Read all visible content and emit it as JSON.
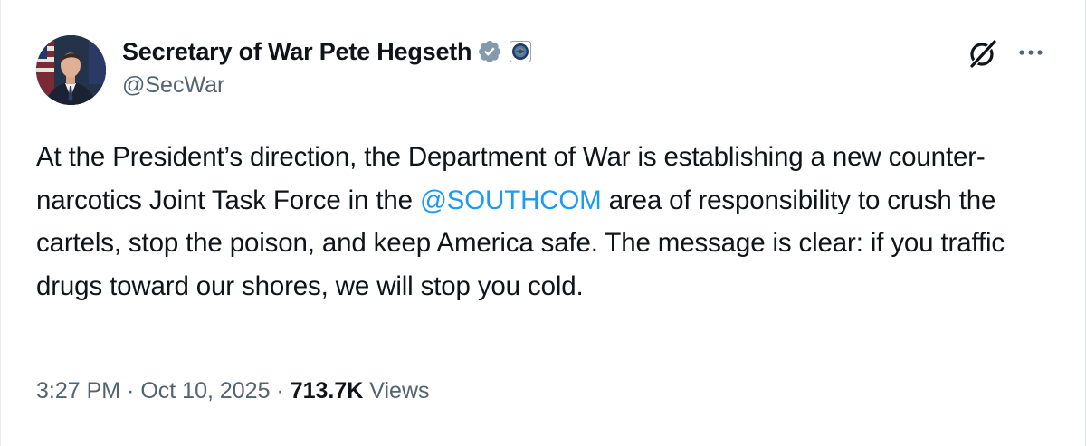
{
  "author": {
    "display_name": "Secretary of War Pete Hegseth",
    "handle": "@SecWar",
    "verified_icon": "verified-badge-gray-icon",
    "affiliation_icon": "department-seal-icon"
  },
  "actions": {
    "grok_icon": "grok-icon",
    "more_icon": "more-dots-icon"
  },
  "tweet": {
    "text_before_mention": "At the President’s direction, the Department of War is establishing a new counter-narcotics Joint Task Force in the ",
    "mention": "@SOUTHCOM",
    "text_after_mention": " area of responsibility to crush the cartels, stop the poison, and keep America safe. The message is clear: if you traffic drugs toward our shores, we will stop you cold."
  },
  "meta": {
    "time": "3:27 PM",
    "separator": " · ",
    "date": "Oct 10, 2025",
    "views_count": "713.7K",
    "views_label": " Views"
  },
  "colors": {
    "text": "#0f1419",
    "secondary": "#536471",
    "link": "#1d9bf0",
    "verified_gray": "#829aab"
  }
}
